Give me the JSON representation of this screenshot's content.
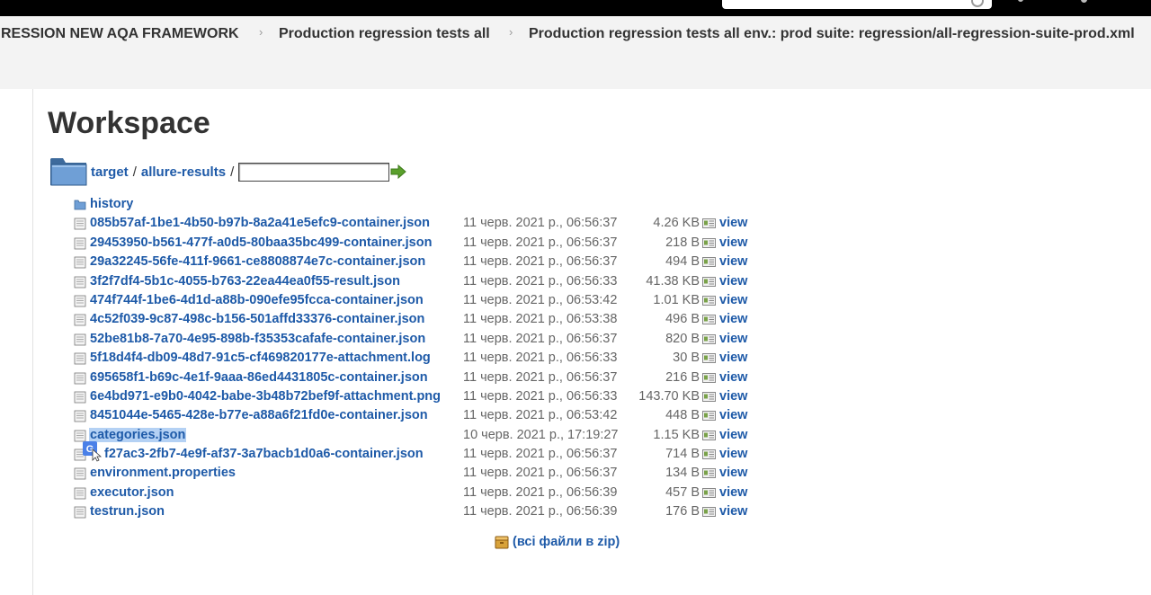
{
  "breadcrumbs": [
    "RESSION NEW AQA FRAMEWORK",
    "Production regression tests all",
    "Production regression tests all env.: prod suite: regression/all-regression-suite-prod.xml"
  ],
  "breadcrumb_separator": "›",
  "page_title": "Workspace",
  "path": {
    "segments": [
      "target",
      "allure-results"
    ],
    "separator": "/",
    "input_value": ""
  },
  "files": [
    {
      "name": "history",
      "type": "folder",
      "date": "",
      "size": ""
    },
    {
      "name": "085b57af-1be1-4b50-b97b-8a2a41e5efc9-container.json",
      "type": "file",
      "date": "11 черв. 2021 р., 06:56:37",
      "size": "4.26 KB"
    },
    {
      "name": "29453950-b561-477f-a0d5-80baa35bc499-container.json",
      "type": "file",
      "date": "11 черв. 2021 р., 06:56:37",
      "size": "218 B"
    },
    {
      "name": "29a32245-56fe-411f-9661-ce8808874e7c-container.json",
      "type": "file",
      "date": "11 черв. 2021 р., 06:56:37",
      "size": "494 B"
    },
    {
      "name": "3f2f7df4-5b1c-4055-b763-22ea44ea0f55-result.json",
      "type": "file",
      "date": "11 черв. 2021 р., 06:56:33",
      "size": "41.38 KB"
    },
    {
      "name": "474f744f-1be6-4d1d-a88b-090efe95fcca-container.json",
      "type": "file",
      "date": "11 черв. 2021 р., 06:53:42",
      "size": "1.01 KB"
    },
    {
      "name": "4c52f039-9c87-498c-b156-501affd33376-container.json",
      "type": "file",
      "date": "11 черв. 2021 р., 06:53:38",
      "size": "496 B"
    },
    {
      "name": "52be81b8-7a70-4e95-898b-f35353cafafe-container.json",
      "type": "file",
      "date": "11 черв. 2021 р., 06:56:37",
      "size": "820 B"
    },
    {
      "name": "5f18d4f4-db09-48d7-91c5-cf469820177e-attachment.log",
      "type": "file",
      "date": "11 черв. 2021 р., 06:56:33",
      "size": "30 B"
    },
    {
      "name": "695658f1-b69c-4e1f-9aaa-86ed4431805c-container.json",
      "type": "file",
      "date": "11 черв. 2021 р., 06:56:37",
      "size": "216 B"
    },
    {
      "name": "6e4bd971-e9b0-4042-babe-3b48b72bef9f-attachment.png",
      "type": "file",
      "date": "11 черв. 2021 р., 06:56:33",
      "size": "143.70 KB"
    },
    {
      "name": "8451044e-5465-428e-b77e-a88a6f21fd0e-container.json",
      "type": "file",
      "date": "11 черв. 2021 р., 06:53:42",
      "size": "448 B"
    },
    {
      "name": "categories.json",
      "type": "file",
      "date": "10 черв. 2021 р., 17:19:27",
      "size": "1.15 KB",
      "selected": true
    },
    {
      "name": "f27ac3-2fb7-4e9f-af37-3a7bacb1d0a6-container.json",
      "type": "file",
      "date": "11 черв. 2021 р., 06:56:37",
      "size": "714 B",
      "translate_badge": true
    },
    {
      "name": "environment.properties",
      "type": "file",
      "date": "11 черв. 2021 р., 06:56:37",
      "size": "134 B"
    },
    {
      "name": "executor.json",
      "type": "file",
      "date": "11 черв. 2021 р., 06:56:39",
      "size": "457 B"
    },
    {
      "name": "testrun.json",
      "type": "file",
      "date": "11 черв. 2021 р., 06:56:39",
      "size": "176 B"
    }
  ],
  "view_label": "view",
  "zip_label": "(всі файли в zip)",
  "colors": {
    "link": "#1e5aa8",
    "selection": "#b4d1f4",
    "breadcrumb_bg": "#f3f3f3"
  }
}
